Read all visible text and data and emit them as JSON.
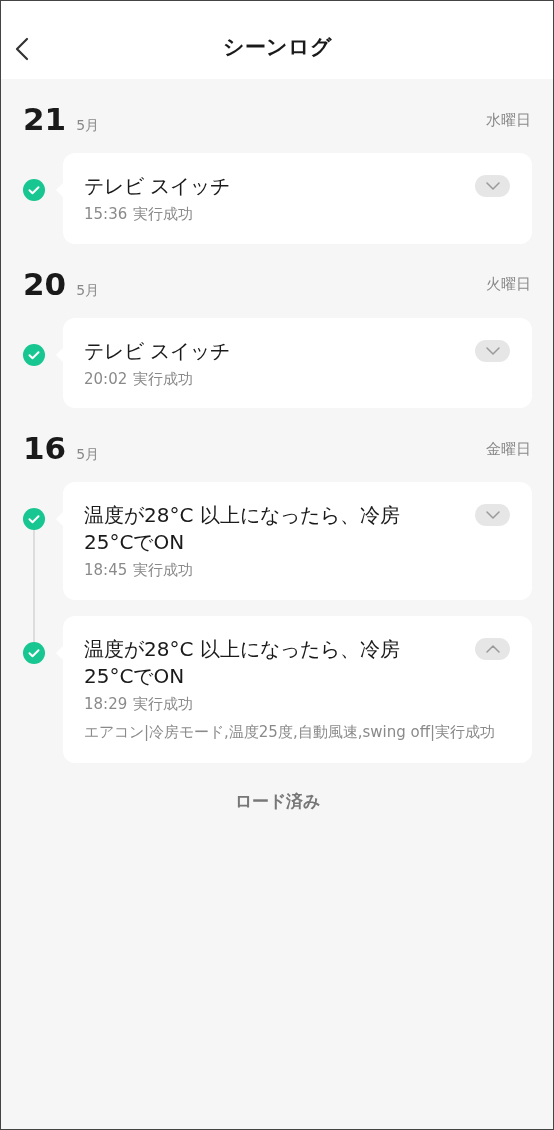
{
  "header": {
    "title": "シーンログ"
  },
  "days": [
    {
      "day": "21",
      "month": "5月",
      "weekday": "水曜日",
      "entries": [
        {
          "title": "テレビ スイッチ",
          "time": "15:36",
          "result": "実行成功",
          "expanded": false
        }
      ]
    },
    {
      "day": "20",
      "month": "5月",
      "weekday": "火曜日",
      "entries": [
        {
          "title": "テレビ スイッチ",
          "time": "20:02",
          "result": "実行成功",
          "expanded": false
        }
      ]
    },
    {
      "day": "16",
      "month": "5月",
      "weekday": "金曜日",
      "entries": [
        {
          "title": "温度が28°C 以上になったら、冷房 25°CでON",
          "time": "18:45",
          "result": "実行成功",
          "expanded": false
        },
        {
          "title": "温度が28°C 以上になったら、冷房 25°CでON",
          "time": "18:29",
          "result": "実行成功",
          "expanded": true,
          "detail": "エアコン|冷房モード,温度25度,自動風速,swing off|実行成功"
        }
      ]
    }
  ],
  "footer": "ロード済み"
}
